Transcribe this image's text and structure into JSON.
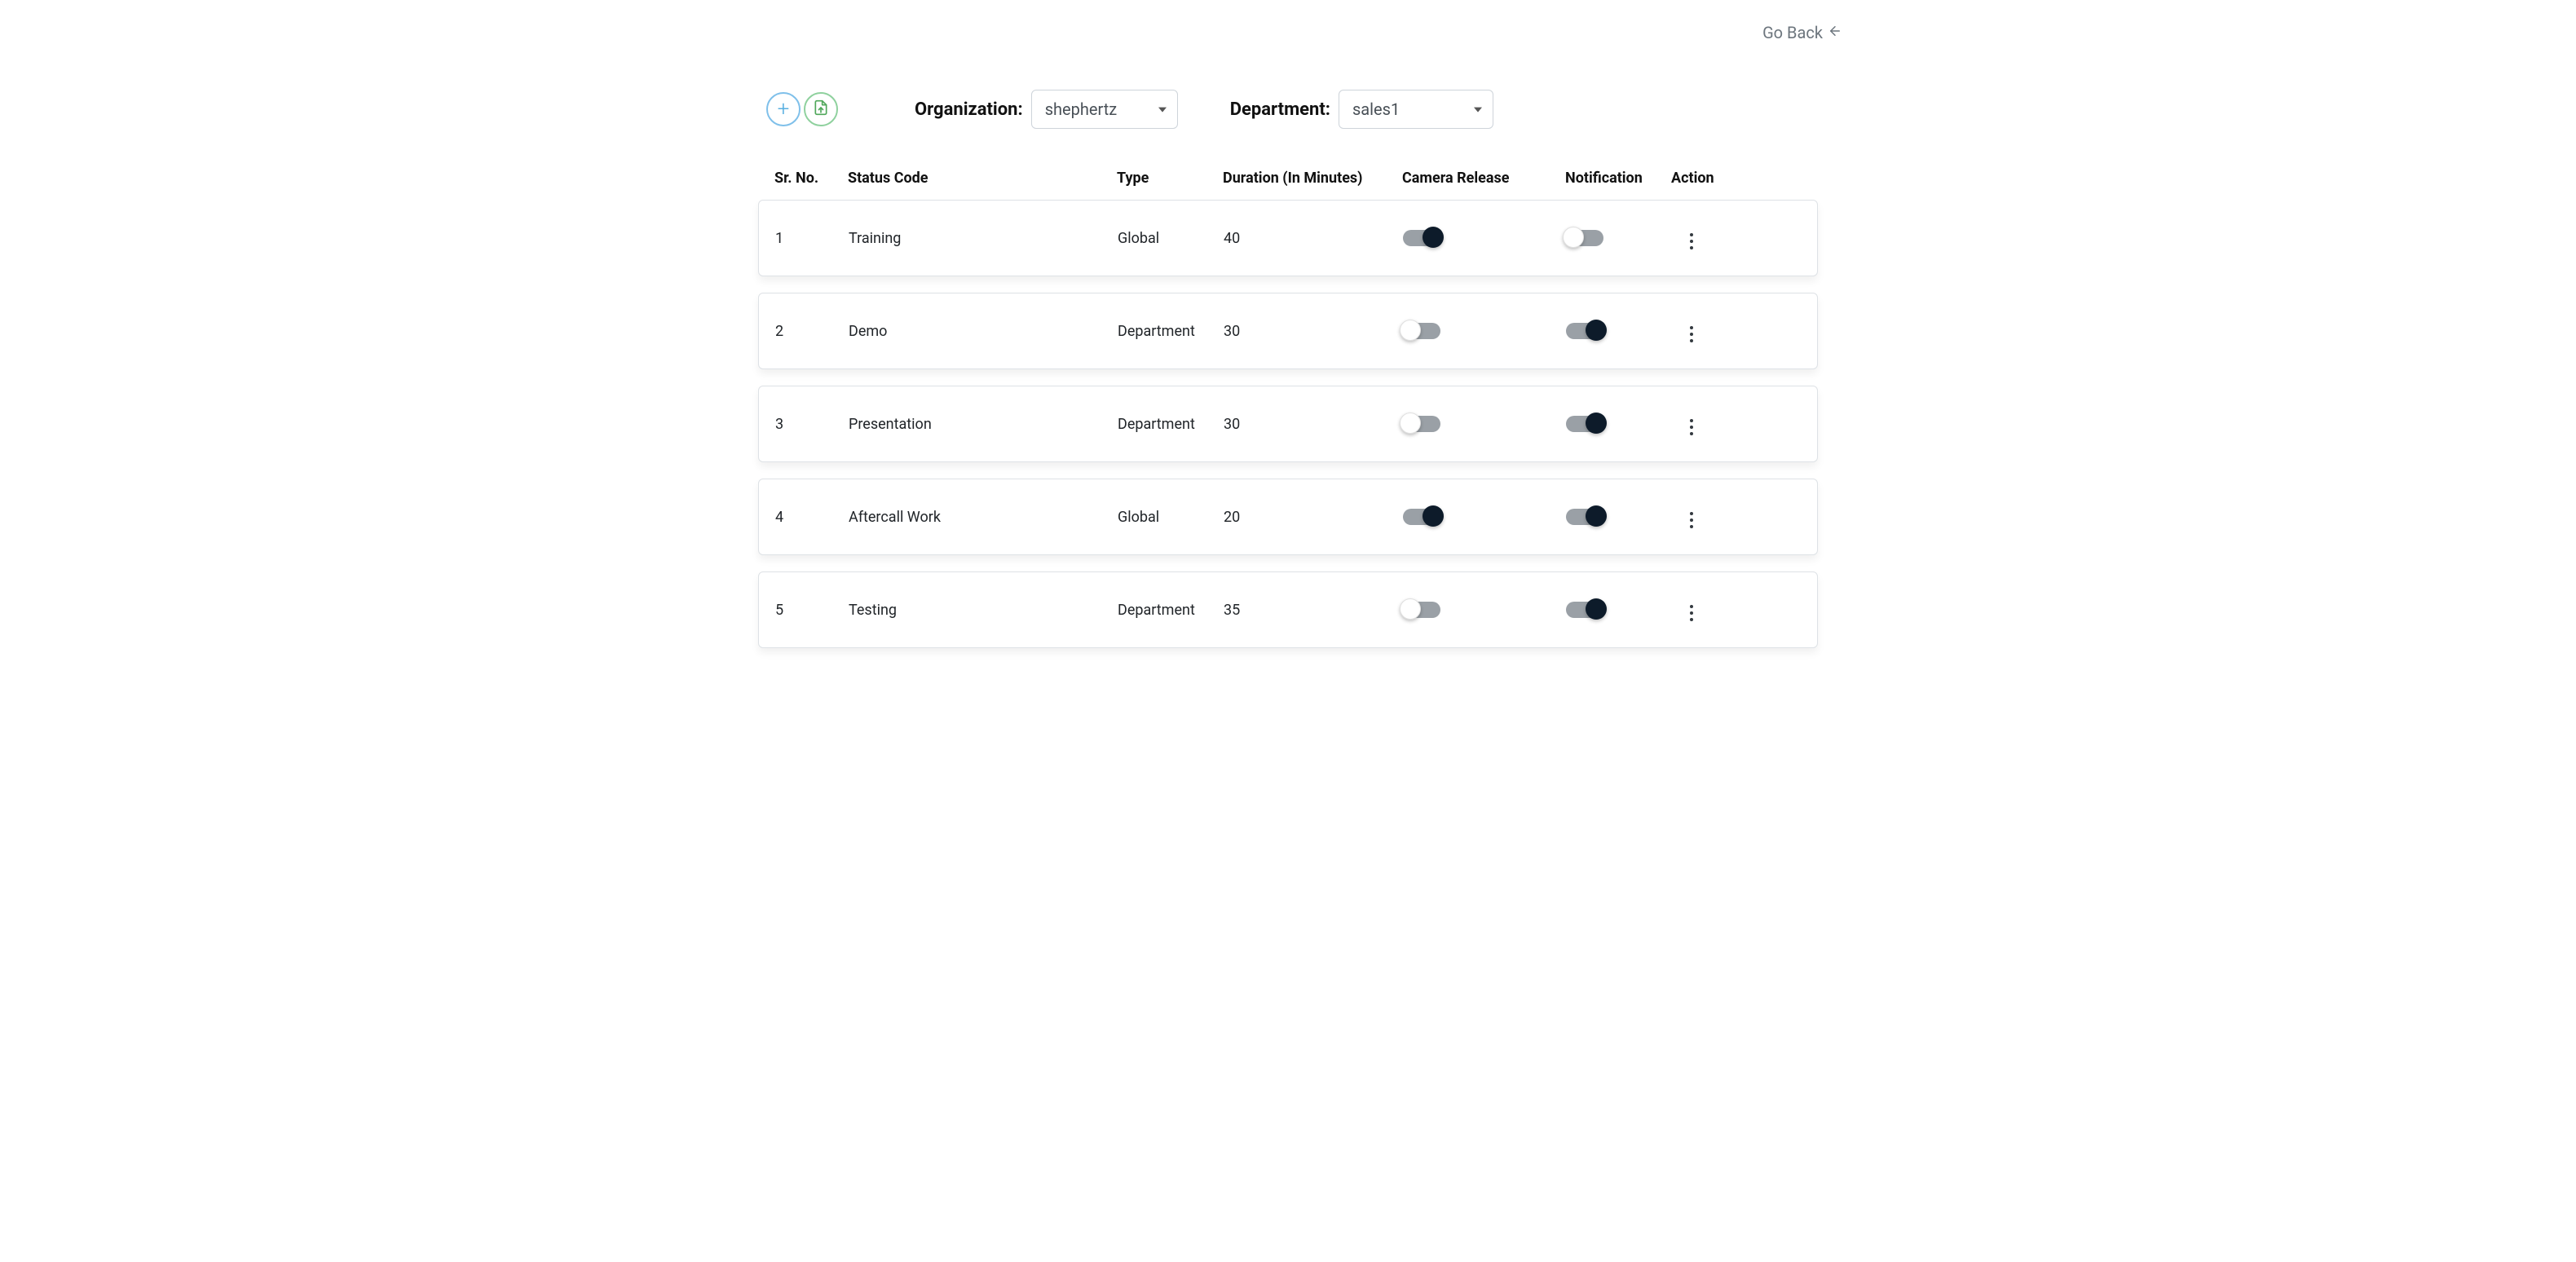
{
  "go_back_label": "Go Back",
  "toolbar": {
    "add_title": "Add",
    "export_title": "Export"
  },
  "filters": {
    "organization_label": "Organization:",
    "organization_value": "shephertz",
    "department_label": "Department:",
    "department_value": "sales1"
  },
  "columns": {
    "sr_no": "Sr. No.",
    "status_code": "Status Code",
    "type": "Type",
    "duration": "Duration (In Minutes)",
    "camera_release": "Camera Release",
    "notification": "Notification",
    "action": "Action"
  },
  "rows": [
    {
      "sr": "1",
      "status": "Training",
      "type": "Global",
      "duration": "40",
      "camera": true,
      "notification": false
    },
    {
      "sr": "2",
      "status": "Demo",
      "type": "Department",
      "duration": "30",
      "camera": false,
      "notification": true
    },
    {
      "sr": "3",
      "status": "Presentation",
      "type": "Department",
      "duration": "30",
      "camera": false,
      "notification": true
    },
    {
      "sr": "4",
      "status": "Aftercall Work",
      "type": "Global",
      "duration": "20",
      "camera": true,
      "notification": true
    },
    {
      "sr": "5",
      "status": "Testing",
      "type": "Department",
      "duration": "35",
      "camera": false,
      "notification": true
    }
  ]
}
